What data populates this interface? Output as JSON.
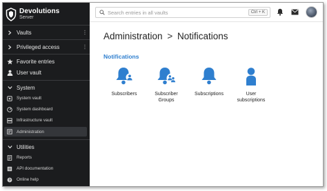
{
  "brand": {
    "line1": "Devolutions",
    "line2": "Server"
  },
  "sidebar": {
    "vaults": "Vaults",
    "privileged_access": "Privileged access",
    "favorite_entries": "Favorite entries",
    "user_vault": "User vault",
    "system": "System",
    "system_items": [
      "System vault",
      "System dashboard",
      "Infrastructure vault",
      "Administration"
    ],
    "utilities": "Utilities",
    "utility_items": [
      "Reports",
      "API documentation",
      "Online help"
    ]
  },
  "search": {
    "placeholder": "Search entries in all vaults",
    "shortcut": "Ctrl + K"
  },
  "page": {
    "title_parent": "Administration",
    "chevron": ">",
    "title_current": "Notifications"
  },
  "section": {
    "title": "Notifications"
  },
  "tiles": [
    "Subscribers",
    "Subscriber\nGroups",
    "Subscriptions",
    "User\nsubscriptions"
  ],
  "colors": {
    "accent": "#2f7fcf",
    "sidebar_bg": "#1b1c1e",
    "selected_bg": "#34363a"
  },
  "icons": {
    "brand": "devolutions-shield-icon",
    "tiles": [
      "bell-user-icon",
      "bell-users-icon",
      "bell-icon",
      "user-icon"
    ]
  }
}
